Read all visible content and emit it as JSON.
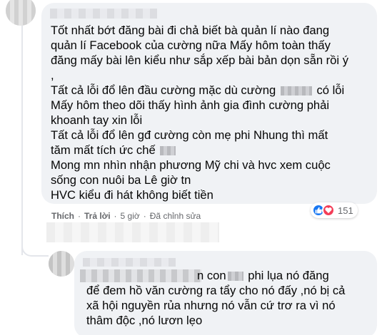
{
  "comment": {
    "lines": [
      "Tốt nhất bớt đăng bài đi chả biết bà quản lí nào đang",
      "quản lí Facebook của cường nữa Mấy hôm toàn thấy",
      "đăng mấy bài lên kiểu như sắp xếp bài bản dọn sẵn rồi ý",
      ",",
      "Tất cả lỗi đổ lên đầu cường mặc dù cường",
      "có lỗi",
      "Mấy hôm theo dõi thấy hình ảnh gia đình cường phải",
      "khoanh tay xin lỗi",
      "Tất cả lỗi đổ lên gđ cường còn mẹ phi Nhung thì mất",
      "tăm mất tích ức chế",
      "Mong mn nhìn nhận phương Mỹ chi và hvc xem cuộc",
      "sống con nuôi ba Lê giờ tn",
      "HVC kiểu đi hát không biết tiền"
    ],
    "actions": {
      "like": "Thích",
      "reply": "Trả lời",
      "time": "5 giờ",
      "edited": "Đã chỉnh sửa"
    },
    "reaction_count": "151",
    "reaction_icons": [
      "like-icon",
      "love-icon"
    ]
  },
  "reply": {
    "first_line_visible_a": "n con",
    "first_line_visible_b": "phi lụa nó đăng",
    "lines": [
      "để đem hồ văn cường ra tẩy cho nó đấy ,nó bị cả",
      "xã hội nguyền rủa nhưng nó vẫn cứ trơ ra vì nó",
      "thâm độc ,nó lươn lẹo"
    ]
  },
  "colors": {
    "bubble_bg": "#f0f2f5",
    "text": "#050505",
    "meta": "#65676b",
    "like_blue": "#1877f2",
    "love_red": "#f33e58"
  }
}
